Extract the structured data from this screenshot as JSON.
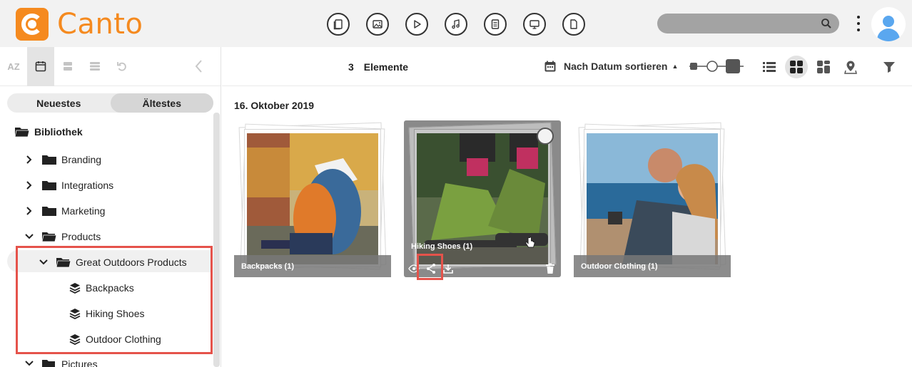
{
  "app": {
    "name": "Canto"
  },
  "header": {
    "type_filters": [
      "all-files-icon",
      "image-icon",
      "video-icon",
      "audio-icon",
      "document-icon",
      "presentation-icon",
      "other-icon"
    ],
    "search_placeholder": ""
  },
  "sidebar": {
    "tools": [
      "AZ",
      "calendar-icon",
      "layout-icon",
      "stack-icon",
      "undo-icon"
    ],
    "sort_tabs": [
      {
        "label": "Neuestes"
      },
      {
        "label": "Ältestes",
        "active": true
      }
    ],
    "tree": {
      "root": "Bibliothek",
      "items": [
        {
          "label": "Branding"
        },
        {
          "label": "Integrations"
        },
        {
          "label": "Marketing"
        },
        {
          "label": "Products"
        },
        {
          "label": "Great Outdoors Products"
        },
        {
          "label": "Backpacks"
        },
        {
          "label": "Hiking Shoes"
        },
        {
          "label": "Outdoor Clothing"
        },
        {
          "label": "Pictures"
        }
      ]
    }
  },
  "main": {
    "count_number": "3",
    "count_label": "Elemente",
    "sort_label": "Nach Datum sortieren",
    "date_group": "16. Oktober 2019",
    "cards": [
      {
        "title": "Backpacks (1)"
      },
      {
        "title": "Hiking Shoes (1)"
      },
      {
        "title": "Outdoor Clothing (1)"
      }
    ]
  },
  "colors": {
    "brand": "#f58a1f",
    "highlight": "#e5534b"
  }
}
